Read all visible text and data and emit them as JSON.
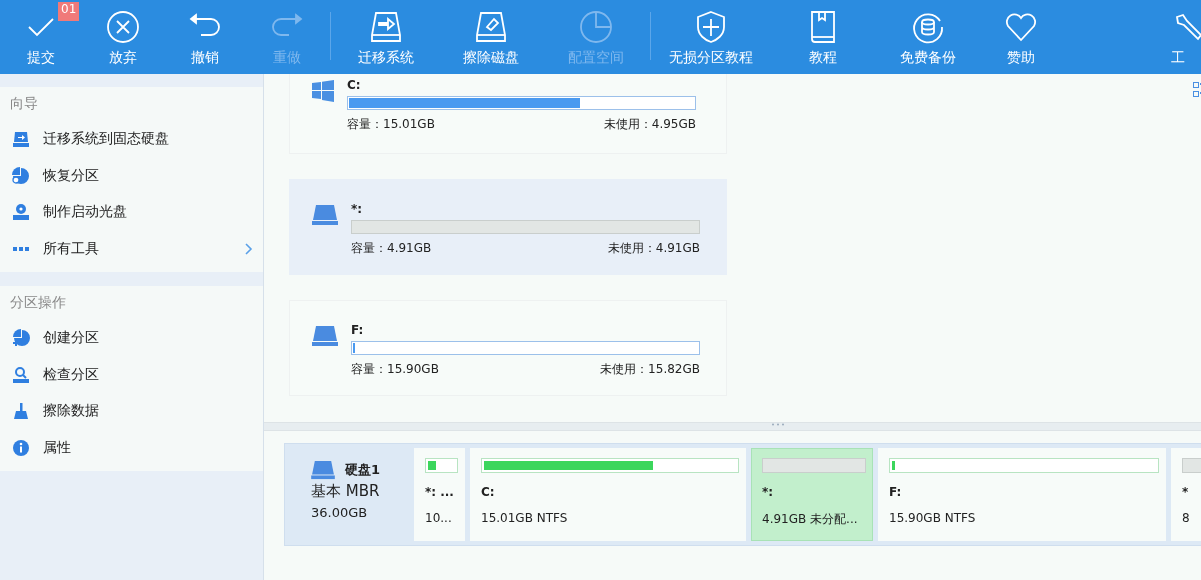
{
  "toolbar": {
    "items": [
      {
        "label": "提交",
        "disabled": false,
        "badge": "01"
      },
      {
        "label": "放弃",
        "disabled": false
      },
      {
        "label": "撤销",
        "disabled": false
      },
      {
        "label": "重做",
        "disabled": true
      },
      {
        "kind": "separator"
      },
      {
        "label": "迁移系统",
        "disabled": false
      },
      {
        "label": "擦除磁盘",
        "disabled": false
      },
      {
        "label": "配置空间",
        "disabled": true
      },
      {
        "kind": "separator"
      },
      {
        "label": "无损分区教程",
        "disabled": false
      },
      {
        "label": "教程",
        "disabled": false
      },
      {
        "label": "免费备份",
        "disabled": false
      },
      {
        "label": "赞助",
        "disabled": false
      },
      {
        "kind": "spacer"
      },
      {
        "label": "工",
        "disabled": false
      }
    ]
  },
  "sidebar": {
    "sections": [
      {
        "title": "向导",
        "items": [
          {
            "label": "迁移系统到固态硬盘",
            "submenu": false
          },
          {
            "label": "恢复分区",
            "submenu": false
          },
          {
            "label": "制作启动光盘",
            "submenu": false
          },
          {
            "label": "所有工具",
            "submenu": true
          }
        ]
      },
      {
        "title": "分区操作",
        "items": [
          {
            "label": "创建分区",
            "submenu": false
          },
          {
            "label": "检查分区",
            "submenu": false
          },
          {
            "label": "擦除数据",
            "submenu": false
          },
          {
            "label": "属性",
            "submenu": false
          }
        ]
      }
    ]
  },
  "partitions": [
    {
      "kind": "system",
      "name": "C:",
      "level": 0.67,
      "capacity": "容量：15.01GB",
      "free": "未使用：4.95GB",
      "selected": false
    },
    {
      "kind": "unallocated",
      "name": "*:",
      "capacity": "容量：4.91GB",
      "free": "未使用：4.91GB",
      "selected": true
    },
    {
      "kind": "data",
      "name": "F:",
      "level": 0.005,
      "capacity": "容量：15.90GB",
      "free": "未使用：15.82GB",
      "selected": false
    }
  ],
  "disk_map": {
    "disk": {
      "name": "硬盘1",
      "type": "基本 MBR",
      "size": "36.00GB"
    },
    "partitions": [
      {
        "kind": "data",
        "name": "*: ...",
        "info": "10...",
        "level": 0.3,
        "selected": false
      },
      {
        "kind": "data",
        "name": "C:",
        "info": "15.01GB NTFS",
        "level": 0.67,
        "selected": false
      },
      {
        "kind": "unallocated",
        "name": "*:",
        "info": "4.91GB 未分配...",
        "selected": true
      },
      {
        "kind": "data",
        "name": "F:",
        "info": "15.90GB NTFS",
        "level": 0.01,
        "selected": false
      },
      {
        "kind": "unallocated",
        "name": "*",
        "info": "8",
        "selected": false
      }
    ]
  }
}
